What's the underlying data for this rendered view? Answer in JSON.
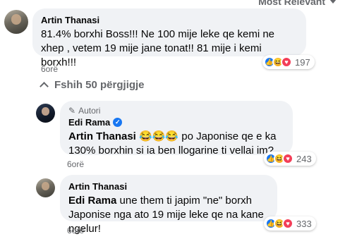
{
  "sort_label": "Most Relevant",
  "comment1": {
    "author": "Artin Thanasi",
    "text": "81.4% borxhi Boss!!! Ne 100 mije leke qe kemi ne xhep , vetem 19 mije jane tonat!! 81 mije i kemi borxh!!!",
    "time": "6orë",
    "reactions": [
      "like",
      "haha",
      "love"
    ],
    "reaction_count": "197"
  },
  "hide_replies_label": "Fshih 50 përgjigje",
  "reply1": {
    "badge": "Autori",
    "author": "Edi Rama",
    "mention": "Artin Thanasi",
    "emojis": "😂😂😂",
    "text": "po Japonise qe e ka 130% borxhin si ia ben llogarine ti vellai im?",
    "time": "6orë",
    "reactions": [
      "like",
      "haha",
      "love"
    ],
    "reaction_count": "243"
  },
  "reply2": {
    "author": "Artin Thanasi",
    "mention": "Edi Rama",
    "text": "une them ti japim \"ne\" borxh Japonise nga ato 19 mije leke qe na kane ngelur!",
    "time": "6orë",
    "reactions": [
      "like",
      "haha",
      "love"
    ],
    "reaction_count": "333"
  },
  "colors": {
    "bubble": "#f0f2f5",
    "meta": "#65676b",
    "like": "#1877f2",
    "haha": "#f7b125",
    "love": "#f33e58"
  }
}
